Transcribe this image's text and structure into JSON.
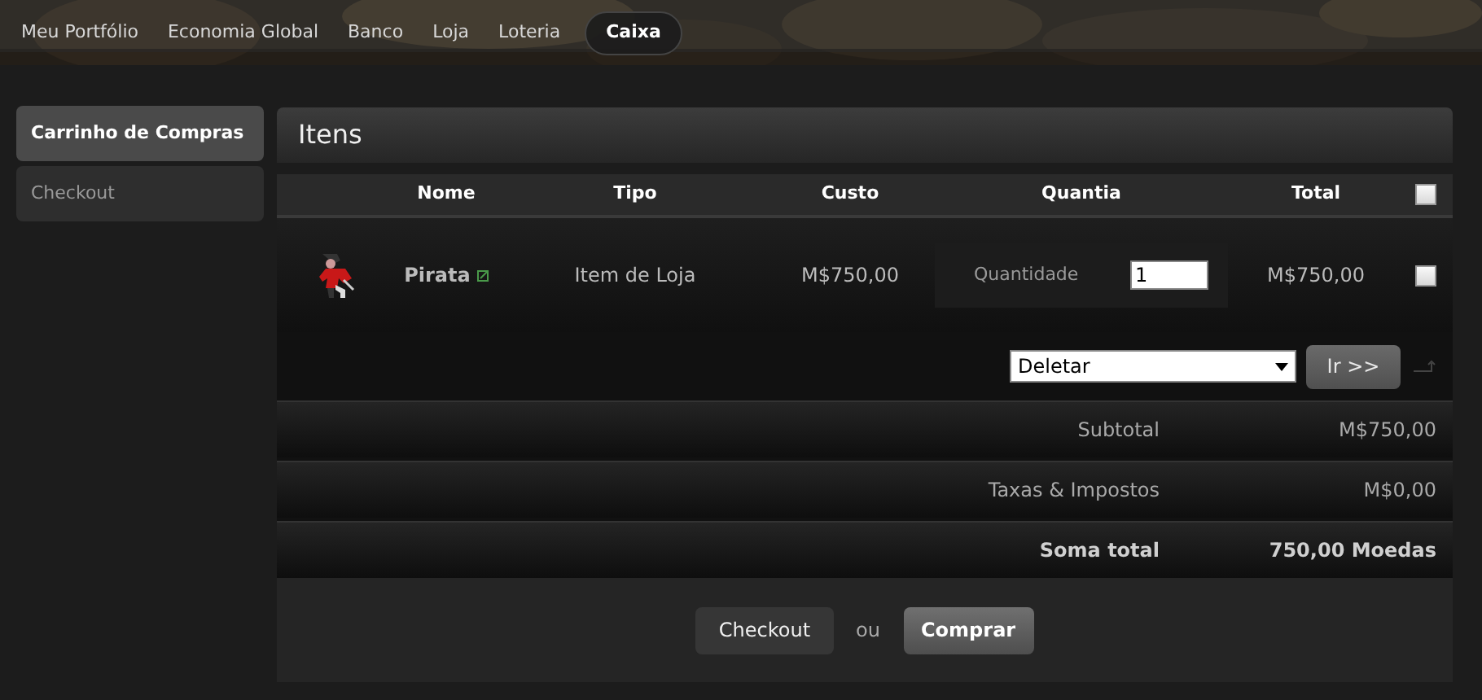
{
  "nav": [
    {
      "label": "Meu Portfólio",
      "selected": false
    },
    {
      "label": "Economia Global",
      "selected": false
    },
    {
      "label": "Banco",
      "selected": false
    },
    {
      "label": "Loja",
      "selected": false
    },
    {
      "label": "Loteria",
      "selected": false
    },
    {
      "label": "Caixa",
      "selected": true
    }
  ],
  "sidebar": {
    "items": [
      {
        "label": "Carrinho de Compras",
        "selected": true
      },
      {
        "label": "Checkout",
        "selected": false
      }
    ]
  },
  "panel": {
    "title": "Itens"
  },
  "table": {
    "columns": [
      "Nome",
      "Tipo",
      "Custo",
      "Quantia",
      "Total"
    ],
    "select_all_checked": false,
    "rows": [
      {
        "name": "Pirata",
        "type": "Item de Loja",
        "cost": "M$750,00",
        "quantity_label": "Quantidade",
        "quantity": "1",
        "total": "M$750,00",
        "checked": false
      }
    ]
  },
  "bulk_action": {
    "value": "Deletar",
    "button": "Ir >>"
  },
  "summary": [
    {
      "label": "Subtotal",
      "value": "M$750,00",
      "bold": false
    },
    {
      "label": "Taxas & Impostos",
      "value": "M$0,00",
      "bold": false
    },
    {
      "label": "Soma total",
      "value": "750,00 Moedas",
      "bold": true
    }
  ],
  "actions": {
    "checkout": "Checkout",
    "separator": "ou",
    "buy": "Comprar"
  }
}
